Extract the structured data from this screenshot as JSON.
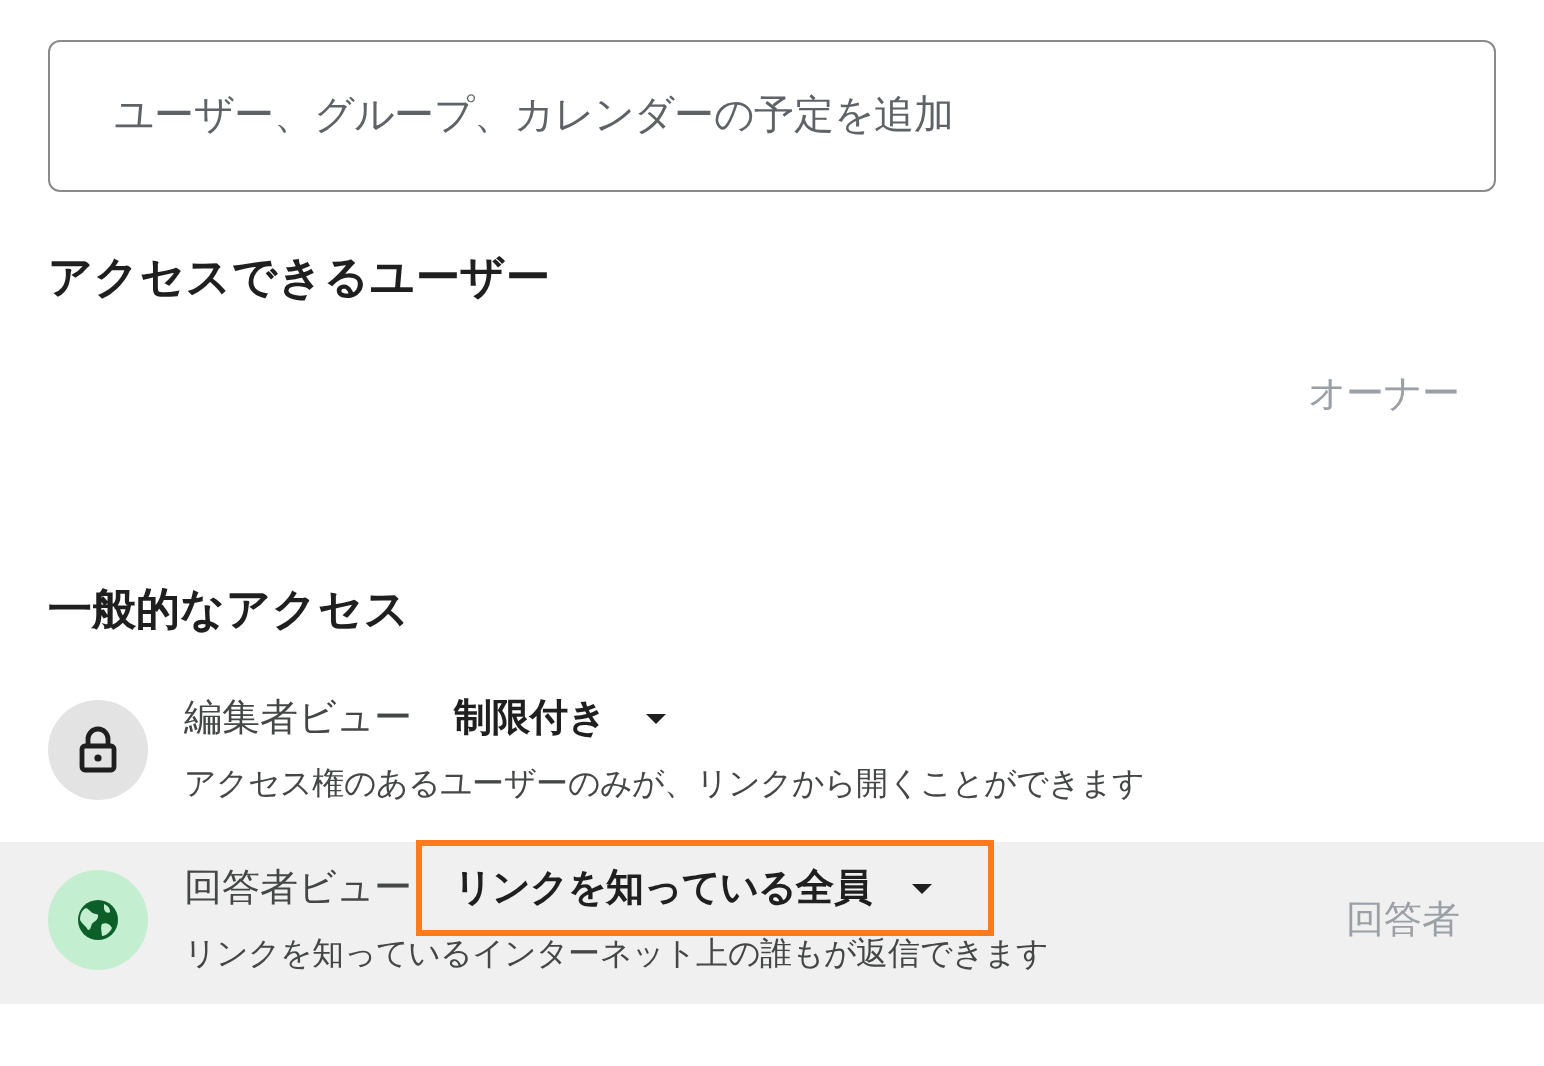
{
  "search": {
    "placeholder": "ユーザー、グループ、カレンダーの予定を追加"
  },
  "people_section": {
    "title": "アクセスできるユーザー",
    "owner_role": "オーナー"
  },
  "general_access": {
    "title": "一般的なアクセス",
    "rows": [
      {
        "kind": "lock",
        "label": "編集者ビュー",
        "dropdown": "制限付き",
        "description": "アクセス権のあるユーザーのみが、リンクから開くことができます",
        "selected": false,
        "highlighted": false
      },
      {
        "kind": "globe",
        "label": "回答者ビュー",
        "dropdown": "リンクを知っている全員",
        "description": "リンクを知っているインターネット上の誰もが返信できます",
        "role": "回答者",
        "selected": true,
        "highlighted": true
      }
    ]
  }
}
